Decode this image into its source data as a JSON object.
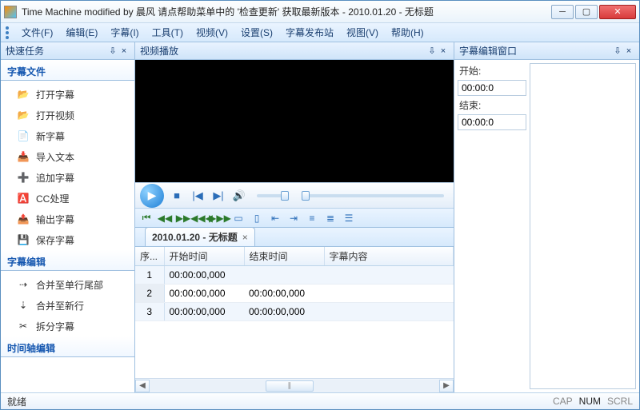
{
  "window": {
    "title": "Time Machine modified by 晨风 请点帮助菜单中的 '检查更新' 获取最新版本 - 2010.01.20 - 无标题"
  },
  "menu": [
    "文件(F)",
    "编辑(E)",
    "字幕(I)",
    "工具(T)",
    "视频(V)",
    "设置(S)",
    "字幕发布站",
    "视图(V)",
    "帮助(H)"
  ],
  "panes": {
    "tasks_title": "快速任务",
    "video_title": "视频播放",
    "edit_title": "字幕编辑窗口"
  },
  "sections": {
    "file": "字幕文件",
    "edit": "字幕编辑",
    "timeline": "时间轴编辑"
  },
  "tasks_file": [
    "打开字幕",
    "打开视频",
    "新字幕",
    "导入文本",
    "追加字幕",
    "CC处理",
    "输出字幕",
    "保存字幕"
  ],
  "tasks_edit": [
    "合并至单行尾部",
    "合并至新行",
    "拆分字幕"
  ],
  "tab": {
    "label": "2010.01.20 - 无标题"
  },
  "grid": {
    "headers": [
      "序...",
      "开始时间",
      "结束时间",
      "字幕内容"
    ],
    "rows": [
      {
        "n": "1",
        "start": "00:00:00,000",
        "end": ""
      },
      {
        "n": "2",
        "start": "00:00:00,000",
        "end": "00:00:00,000"
      },
      {
        "n": "3",
        "start": "00:00:00,000",
        "end": "00:00:00,000"
      }
    ]
  },
  "edit": {
    "start_label": "开始:",
    "start_val": "00:00:0",
    "end_label": "结束:",
    "end_val": "00:00:0"
  },
  "status": {
    "ready": "就绪",
    "cap": "CAP",
    "num": "NUM",
    "scrl": "SCRL"
  }
}
